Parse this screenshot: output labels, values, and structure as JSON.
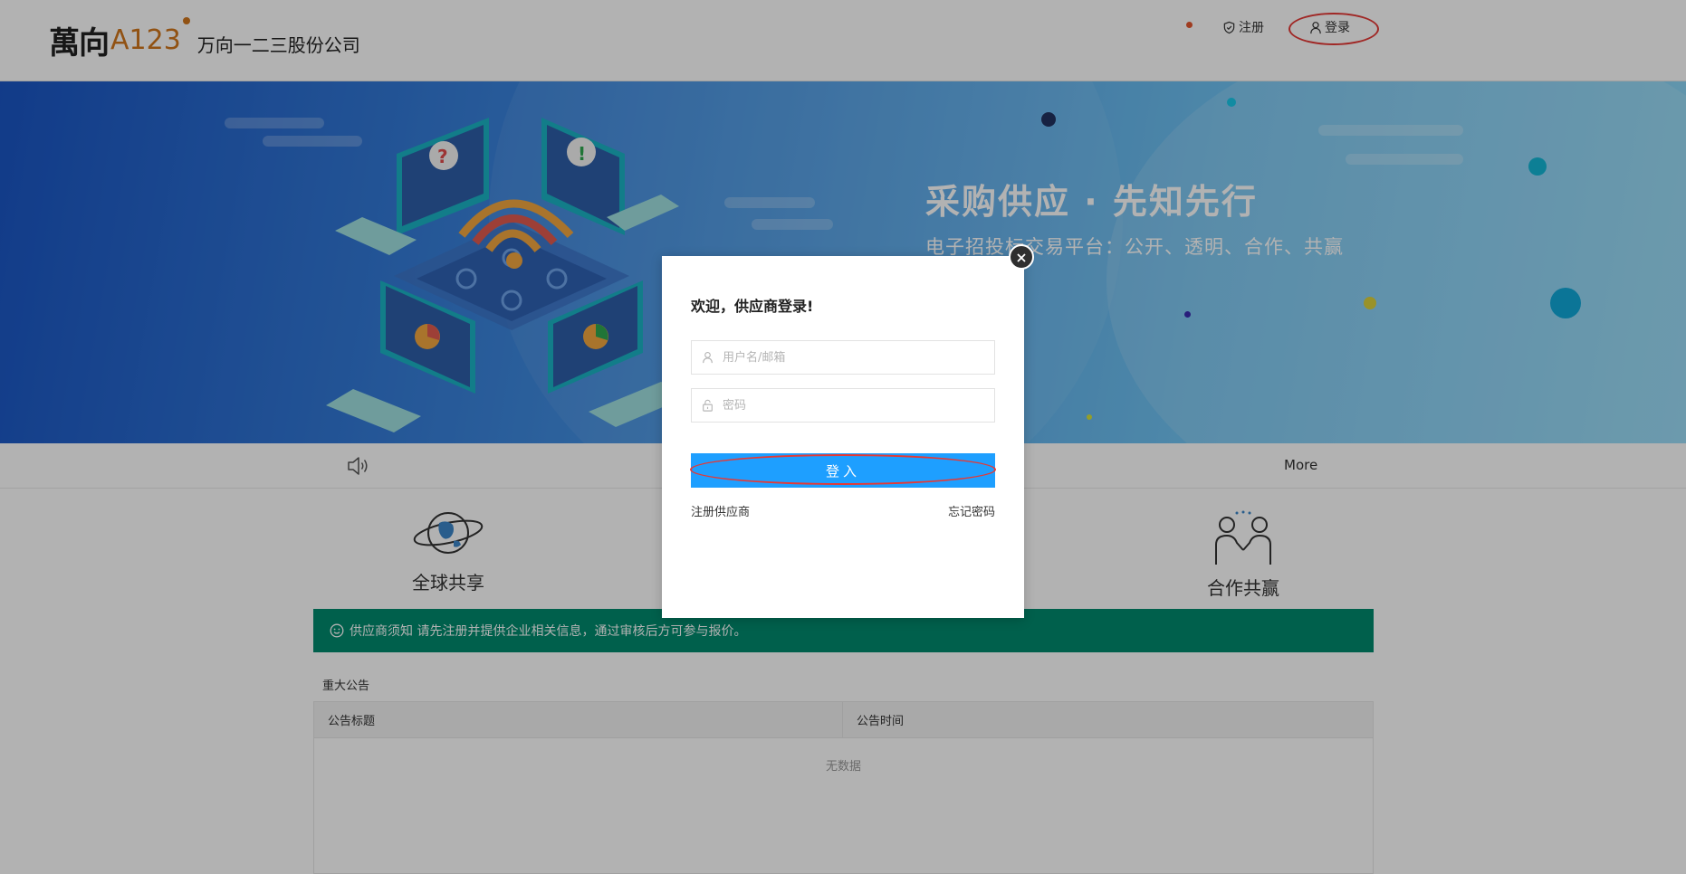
{
  "header": {
    "logo_mark": "萬向",
    "logo_a123": "A123",
    "company_name": "万向一二三股份公司",
    "register_label": "注册",
    "login_label": "登录"
  },
  "banner": {
    "slogan": "采购供应 · 先知先行",
    "sub_slogan": "电子招投标交易平台：公开、透明、合作、共赢"
  },
  "notice_bar": {
    "more_label": "More"
  },
  "features": {
    "global_label": "全球共享",
    "coop_label": "合作共赢"
  },
  "tip": {
    "text": "供应商须知 请先注册并提供企业相关信息，通过审核后方可参与报价。"
  },
  "announcements": {
    "section_title": "重大公告",
    "columns": [
      "公告标题",
      "公告时间"
    ],
    "empty_text": "无数据"
  },
  "login_modal": {
    "title": "欢迎，供应商登录!",
    "username_placeholder": "用户名/邮箱",
    "password_placeholder": "密码",
    "submit_label": "登入",
    "register_link": "注册供应商",
    "forgot_link": "忘记密码"
  },
  "icons": {
    "register": "shield-check-icon",
    "login": "user-icon",
    "speaker": "speaker-icon",
    "tip": "smile-icon",
    "username": "user-icon",
    "password": "lock-icon",
    "close": "close-icon"
  },
  "colors": {
    "primary_button": "#1e9fff",
    "tip_background": "#008a6d",
    "logo_accent": "#d0761c",
    "annotation_red": "#e53935"
  }
}
